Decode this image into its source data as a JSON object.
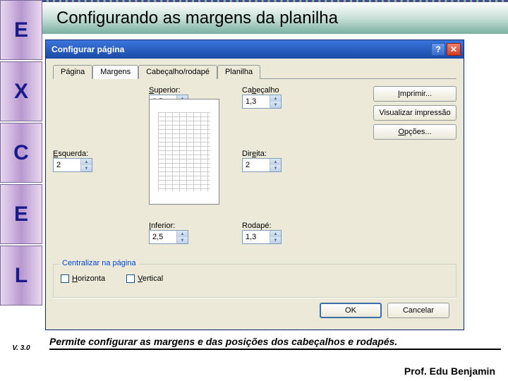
{
  "sidebar": {
    "letters": [
      "E",
      "X",
      "C",
      "E",
      "L"
    ],
    "version": "V. 3.0"
  },
  "title": "Configurando as margens  da planilha",
  "dialog": {
    "title": "Configurar página",
    "tabs": [
      "Página",
      "Margens",
      "Cabeçalho/rodapé",
      "Planilha"
    ],
    "fields": {
      "superior": {
        "label": "Superior:",
        "value": "2,5"
      },
      "cabecalho": {
        "label": "Cabeçalho",
        "value": "1,3"
      },
      "esquerda": {
        "label": "Esquerda:",
        "value": "2"
      },
      "direita": {
        "label": "Direita:",
        "value": "2"
      },
      "inferior": {
        "label": "Inferior:",
        "value": "2,5"
      },
      "rodape": {
        "label": "Rodapé:",
        "value": "1,3"
      }
    },
    "buttons": {
      "imprimir": "Imprimir...",
      "visualizar": "Visualizar impressão",
      "opcoes": "Opções..."
    },
    "centralize": {
      "title": "Centralizar na página",
      "horizontal": "Horizonta",
      "vertical": "Vertical"
    },
    "ok": "OK",
    "cancel": "Cancelar"
  },
  "description": "Permite configurar as margens e das posições dos cabeçalhos e rodapés.",
  "footer": "Prof. Edu Benjamin"
}
